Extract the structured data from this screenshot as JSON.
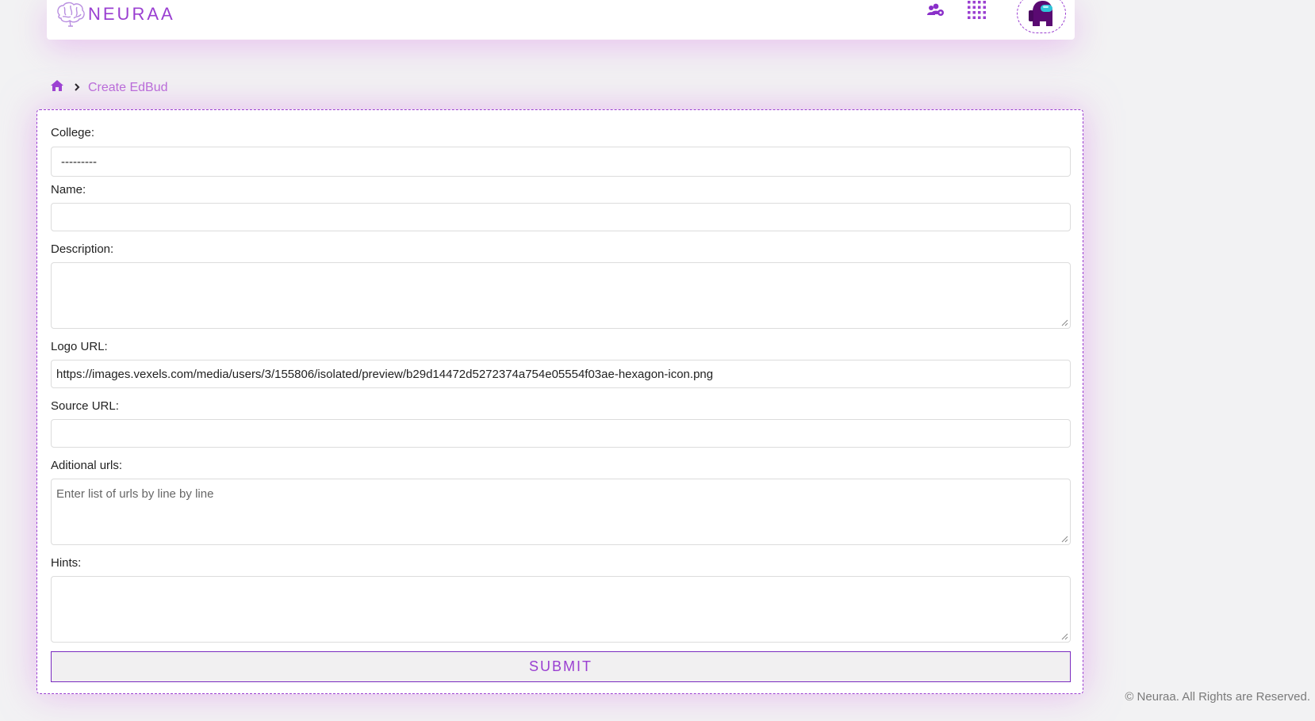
{
  "brand": {
    "name": "NEURAA"
  },
  "header": {
    "icons": [
      "users-gear-icon",
      "apps-grid-icon",
      "avatar-icon"
    ],
    "accent": "#9a3fd1"
  },
  "breadcrumb": {
    "home_icon": "home-icon",
    "separator": "chevron-right-icon",
    "current": "Create EdBud"
  },
  "form": {
    "college": {
      "label": "College:",
      "value": "---------"
    },
    "name": {
      "label": "Name:",
      "value": ""
    },
    "description": {
      "label": "Description:",
      "value": ""
    },
    "logo_url": {
      "label": "Logo URL:",
      "value": "https://images.vexels.com/media/users/3/155806/isolated/preview/b29d14472d5272374a754e05554f03ae-hexagon-icon.png"
    },
    "source_url": {
      "label": "Source URL:",
      "value": ""
    },
    "additional_urls": {
      "label": "Aditional urls:",
      "placeholder": "Enter list of urls by line by line"
    },
    "hints": {
      "label": "Hints:",
      "value": ""
    },
    "submit_label": "SUBMIT"
  },
  "footer": {
    "text": "© Neuraa. All Rights are Reserved."
  }
}
